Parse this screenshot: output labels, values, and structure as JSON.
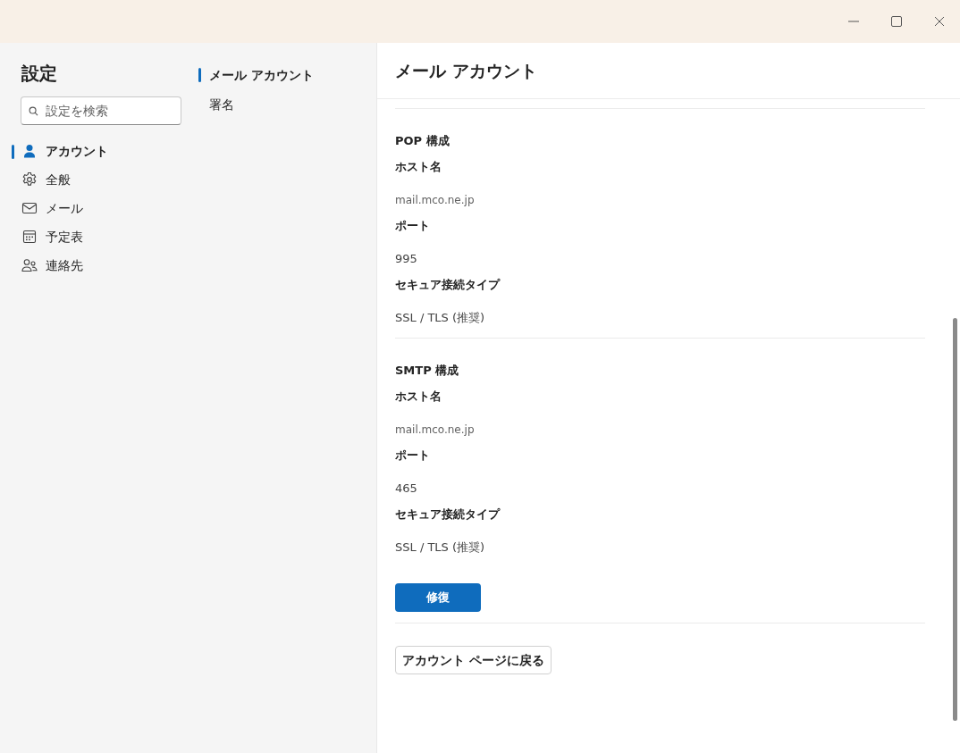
{
  "sidebar": {
    "title": "設定",
    "search": {
      "placeholder": "設定を検索"
    },
    "items": [
      {
        "label": "アカウント",
        "kind": "person",
        "selected": true
      },
      {
        "label": "全般",
        "kind": "gear",
        "selected": false
      },
      {
        "label": "メール",
        "kind": "mail",
        "selected": false
      },
      {
        "label": "予定表",
        "kind": "calendar",
        "selected": false
      },
      {
        "label": "連絡先",
        "kind": "people",
        "selected": false
      }
    ]
  },
  "subnav": {
    "items": [
      {
        "label": "メール アカウント",
        "selected": true
      },
      {
        "label": "署名",
        "selected": false
      }
    ]
  },
  "content": {
    "title": "メール アカウント",
    "sections": [
      {
        "title": "POP 構成",
        "fields": [
          {
            "label": "ホスト名",
            "value": "mail.mco.ne.jp",
            "kind": "host"
          },
          {
            "label": "ポート",
            "value": "995",
            "kind": "text"
          },
          {
            "label": "セキュア接続タイプ",
            "value": "SSL / TLS (推奨)",
            "kind": "text"
          }
        ]
      },
      {
        "title": "SMTP 構成",
        "fields": [
          {
            "label": "ホスト名",
            "value": "mail.mco.ne.jp",
            "kind": "host"
          },
          {
            "label": "ポート",
            "value": "465",
            "kind": "text"
          },
          {
            "label": "セキュア接続タイプ",
            "value": "SSL / TLS (推奨)",
            "kind": "text"
          }
        ]
      }
    ],
    "repair_button": "修復",
    "back_button": "アカウント ページに戻る"
  }
}
